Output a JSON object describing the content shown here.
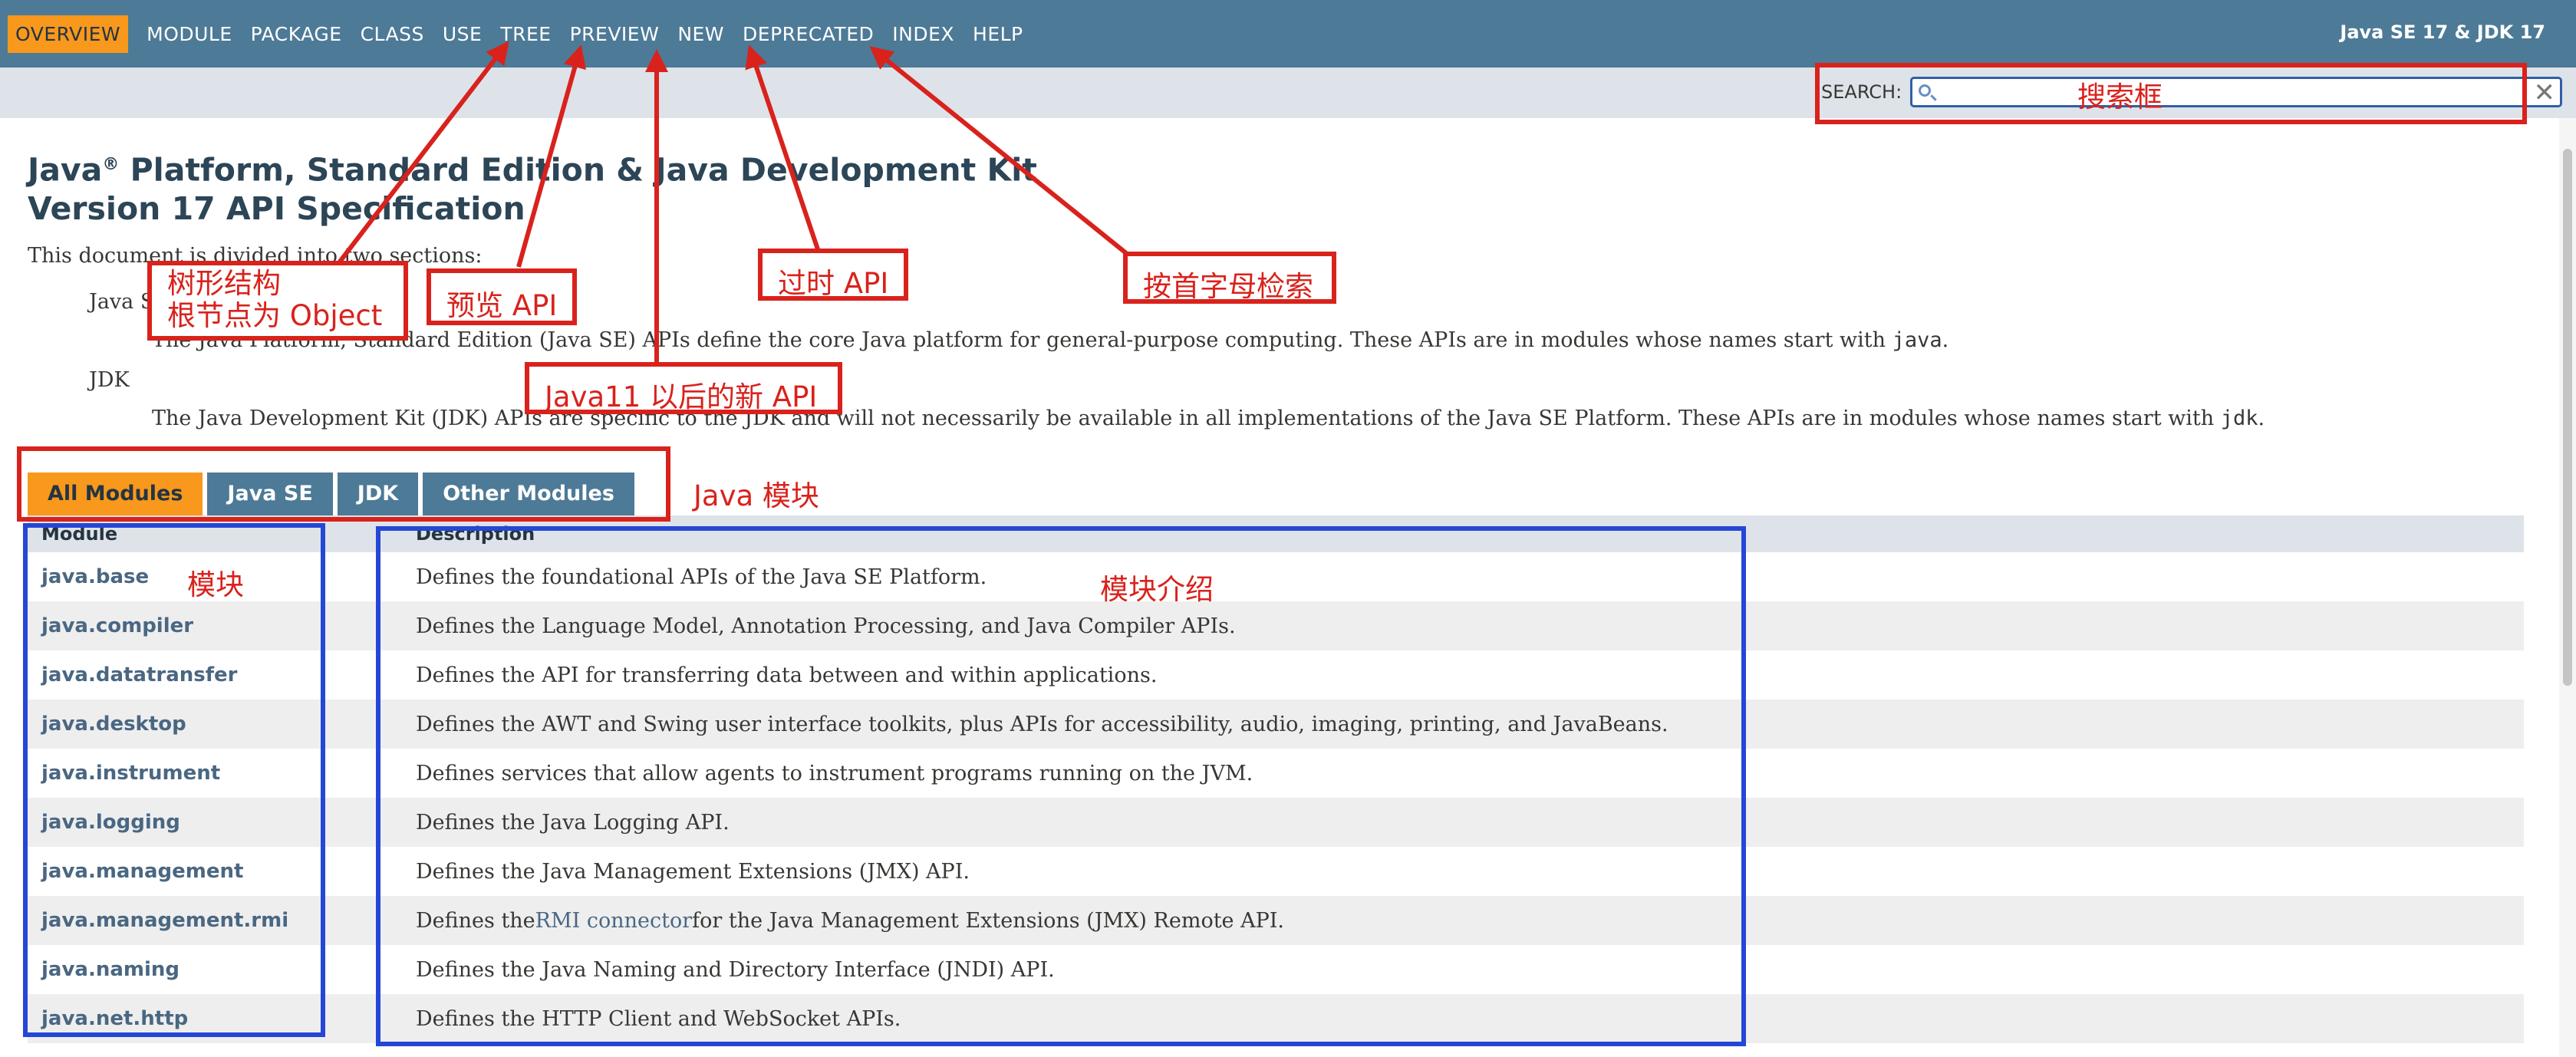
{
  "nav": {
    "items": [
      "OVERVIEW",
      "MODULE",
      "PACKAGE",
      "CLASS",
      "USE",
      "TREE",
      "PREVIEW",
      "NEW",
      "DEPRECATED",
      "INDEX",
      "HELP"
    ],
    "active": "OVERVIEW",
    "right_label": "Java SE 17 & JDK 17"
  },
  "search": {
    "label": "SEARCH:",
    "clear_glyph": "✕"
  },
  "page": {
    "title_line1_pre": "Java",
    "title_reg": "®",
    "title_line1_post": " Platform, Standard Edition & Java Development Kit",
    "title_line2": "Version 17 API Specification",
    "intro": "This document is divided into two sections:",
    "sections": [
      {
        "term": "Java SE",
        "def_pre": "The Java Platform, Standard Edition (Java SE) APIs define the core Java platform for general-purpose computing. These APIs are in modules whose names start with ",
        "def_code": "java",
        "def_post": "."
      },
      {
        "term": "JDK",
        "def_pre": "The Java Development Kit (JDK) APIs are specific to the JDK and will not necessarily be available in all implementations of the Java SE Platform. These APIs are in modules whose names start with ",
        "def_code": "jdk",
        "def_post": "."
      }
    ]
  },
  "tabs": [
    "All Modules",
    "Java SE",
    "JDK",
    "Other Modules"
  ],
  "table": {
    "headers": [
      "Module",
      "Description"
    ],
    "rows": [
      {
        "module": "java.base",
        "desc": "Defines the foundational APIs of the Java SE Platform."
      },
      {
        "module": "java.compiler",
        "desc": "Defines the Language Model, Annotation Processing, and Java Compiler APIs."
      },
      {
        "module": "java.datatransfer",
        "desc": "Defines the API for transferring data between and within applications."
      },
      {
        "module": "java.desktop",
        "desc": "Defines the AWT and Swing user interface toolkits, plus APIs for accessibility, audio, imaging, printing, and JavaBeans."
      },
      {
        "module": "java.instrument",
        "desc": "Defines services that allow agents to instrument programs running on the JVM."
      },
      {
        "module": "java.logging",
        "desc": "Defines the Java Logging API."
      },
      {
        "module": "java.management",
        "desc": "Defines the Java Management Extensions (JMX) API."
      },
      {
        "module": "java.management.rmi",
        "desc_pre": "Defines the ",
        "desc_link": "RMI connector",
        "desc_post": " for the Java Management Extensions (JMX) Remote API."
      },
      {
        "module": "java.naming",
        "desc": "Defines the Java Naming and Directory Interface (JNDI) API."
      },
      {
        "module": "java.net.http",
        "desc": "Defines the HTTP Client and WebSocket APIs."
      }
    ]
  },
  "annotations": {
    "search_box": "搜索框",
    "tree_line1": "树形结构",
    "tree_line2": "根节点为 Object",
    "preview": "预览 API",
    "deprecated": "过时 API",
    "index": "按首字母检索",
    "new": "Java11 以后的新 API",
    "modules_tabs": "Java 模块",
    "module_col": "模块",
    "desc_col": "模块介绍"
  },
  "colors": {
    "nav_bg": "#4d7a97",
    "active_tab": "#f8981d",
    "subnav_bg": "#dee3e9",
    "link": "#4a6782",
    "annotation_red": "#d9221c",
    "annotation_blue": "#2447d6"
  }
}
